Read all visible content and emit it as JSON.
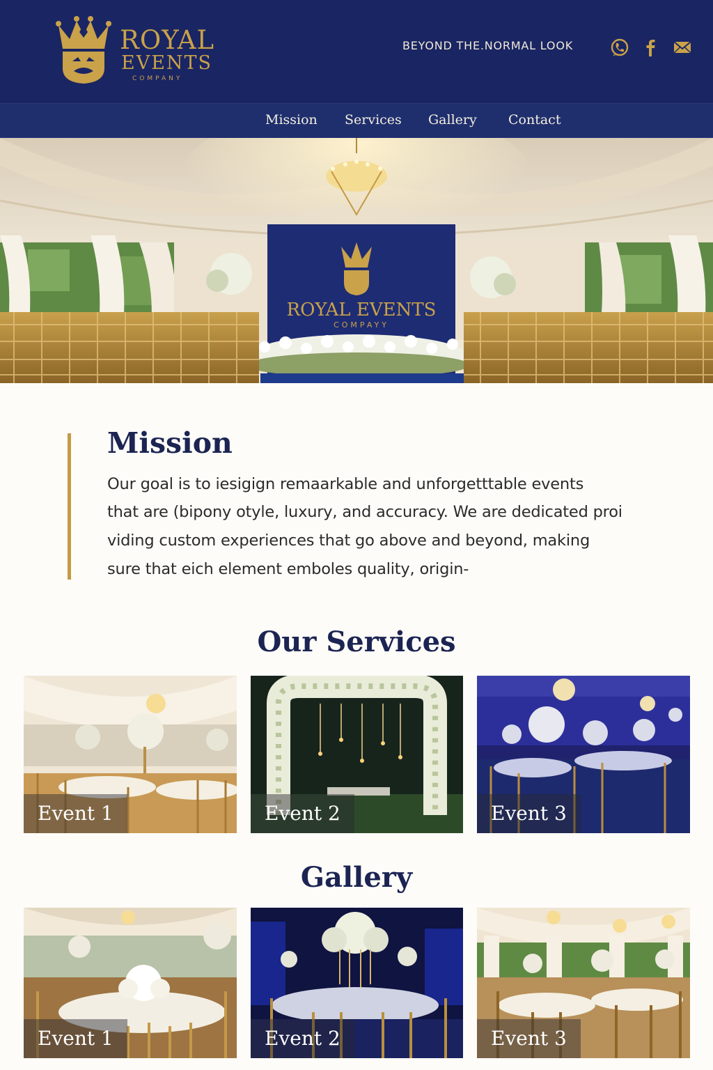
{
  "brand": {
    "line1": "ROYAL",
    "line2": "EVENTS",
    "line3": "COMPANY",
    "hero_sign_line1": "ROYAL EVENTS",
    "hero_sign_line2": "COMPAYY",
    "colors": {
      "navy": "#1a2563",
      "gold": "#c9a24a",
      "nav": "#1f2f6e"
    }
  },
  "header": {
    "tagline": "BEYOND THE.NORMAL LOOK",
    "icons": [
      "phone-icon",
      "facebook-icon",
      "mail-icon"
    ]
  },
  "nav": {
    "items": [
      {
        "label": "Mission"
      },
      {
        "label": "Services"
      },
      {
        "label": "Gallery"
      },
      {
        "label": "Contact"
      }
    ]
  },
  "mission": {
    "title": "Mission",
    "lines": [
      "Our goal is to iesigign remaarkable and unforgetttable events",
      "that are (bipony otyle, luxury, and accuracy. We are dedicated proi",
      "viding custom experiences that go above and beyond, making",
      "sure that eich element emboles quality, origin-"
    ]
  },
  "services": {
    "title": "Our Services",
    "cards": [
      {
        "label": "Event 1"
      },
      {
        "label": "Event 2"
      },
      {
        "label": "Event 3"
      }
    ]
  },
  "gallery": {
    "title": "Gallery",
    "cards": [
      {
        "label": "Event 1"
      },
      {
        "label": "Event 2"
      },
      {
        "label": "Event 3"
      }
    ]
  }
}
